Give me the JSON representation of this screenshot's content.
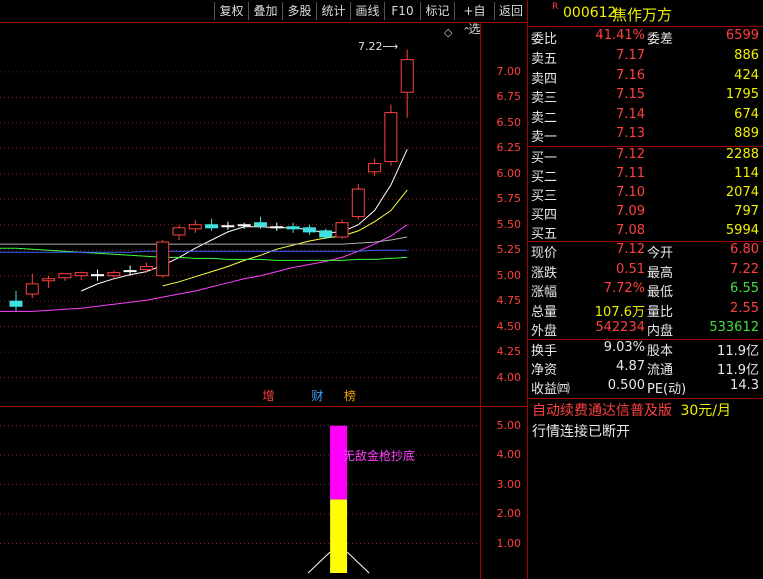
{
  "toolbar": {
    "buttons": [
      "复权",
      "叠加",
      "多股",
      "统计",
      "画线",
      "F10",
      "标记",
      "+自选",
      "返回"
    ]
  },
  "stock": {
    "flag": "R",
    "code": "000612",
    "name": "焦作万方"
  },
  "quote": {
    "webi_label": "委比",
    "webi_value": "41.41%",
    "weicha_label": "委差",
    "weicha_value": "6599",
    "asks": [
      {
        "label": "卖五",
        "price": "7.17",
        "vol": "886"
      },
      {
        "label": "卖四",
        "price": "7.16",
        "vol": "424"
      },
      {
        "label": "卖三",
        "price": "7.15",
        "vol": "1795"
      },
      {
        "label": "卖二",
        "price": "7.14",
        "vol": "674"
      },
      {
        "label": "卖一",
        "price": "7.13",
        "vol": "889"
      }
    ],
    "bids": [
      {
        "label": "买一",
        "price": "7.12",
        "vol": "2288"
      },
      {
        "label": "买二",
        "price": "7.11",
        "vol": "114"
      },
      {
        "label": "买三",
        "price": "7.10",
        "vol": "2074"
      },
      {
        "label": "买四",
        "price": "7.09",
        "vol": "797"
      },
      {
        "label": "买五",
        "price": "7.08",
        "vol": "5994"
      }
    ],
    "stats": [
      {
        "l1": "现价",
        "v1": "7.12",
        "l2": "今开",
        "v2": "6.80"
      },
      {
        "l1": "涨跌",
        "v1": "0.51",
        "l2": "最高",
        "v2": "7.22"
      },
      {
        "l1": "涨幅",
        "v1": "7.72%",
        "l2": "最低",
        "v2": "6.55"
      },
      {
        "l1": "总量",
        "v1": "107.6万",
        "l2": "量比",
        "v2": "2.55"
      },
      {
        "l1": "外盘",
        "v1": "542234",
        "l2": "内盘",
        "v2": "533612"
      }
    ],
    "fund": [
      {
        "l1": "换手",
        "v1": "9.03%",
        "l2": "股本",
        "v2": "11.9亿"
      },
      {
        "l1": "净资",
        "v1": "4.87",
        "l2": "流通",
        "v2": "11.9亿"
      },
      {
        "l1": "收益㈣",
        "v1": "0.500",
        "l2": "PE(动)",
        "v2": "14.3"
      }
    ]
  },
  "ad": {
    "text": "自动续费通达信普及版",
    "price": "30元/月"
  },
  "status": {
    "text": "行情连接已断开"
  },
  "chart_data": [
    {
      "type": "candlestick",
      "title": "",
      "ylim": [
        3.8,
        7.45
      ],
      "yticks": [
        "7.00",
        "6.75",
        "6.50",
        "6.25",
        "6.00",
        "5.75",
        "5.50",
        "5.25",
        "5.00",
        "4.75",
        "4.50",
        "4.25",
        "4.00"
      ],
      "high_annotation": "7.22",
      "candles": [
        {
          "o": 4.75,
          "h": 4.85,
          "l": 4.65,
          "c": 4.7
        },
        {
          "o": 4.82,
          "h": 5.02,
          "l": 4.78,
          "c": 4.92
        },
        {
          "o": 4.95,
          "h": 5.0,
          "l": 4.88,
          "c": 4.97
        },
        {
          "o": 4.98,
          "h": 5.02,
          "l": 4.95,
          "c": 5.02
        },
        {
          "o": 5.0,
          "h": 5.04,
          "l": 4.96,
          "c": 5.03
        },
        {
          "o": 5.01,
          "h": 5.06,
          "l": 4.95,
          "c": 5.01
        },
        {
          "o": 5.0,
          "h": 5.05,
          "l": 4.97,
          "c": 5.03
        },
        {
          "o": 5.04,
          "h": 5.1,
          "l": 5.0,
          "c": 5.05
        },
        {
          "o": 5.06,
          "h": 5.13,
          "l": 5.03,
          "c": 5.09
        },
        {
          "o": 5.0,
          "h": 5.35,
          "l": 4.98,
          "c": 5.33
        },
        {
          "o": 5.4,
          "h": 5.5,
          "l": 5.35,
          "c": 5.47
        },
        {
          "o": 5.46,
          "h": 5.55,
          "l": 5.42,
          "c": 5.5
        },
        {
          "o": 5.5,
          "h": 5.56,
          "l": 5.44,
          "c": 5.47
        },
        {
          "o": 5.49,
          "h": 5.53,
          "l": 5.45,
          "c": 5.49
        },
        {
          "o": 5.5,
          "h": 5.52,
          "l": 5.46,
          "c": 5.5
        },
        {
          "o": 5.52,
          "h": 5.58,
          "l": 5.46,
          "c": 5.49
        },
        {
          "o": 5.48,
          "h": 5.52,
          "l": 5.44,
          "c": 5.47
        },
        {
          "o": 5.48,
          "h": 5.52,
          "l": 5.42,
          "c": 5.46
        },
        {
          "o": 5.47,
          "h": 5.5,
          "l": 5.4,
          "c": 5.43
        },
        {
          "o": 5.44,
          "h": 5.46,
          "l": 5.36,
          "c": 5.38
        },
        {
          "o": 5.38,
          "h": 5.55,
          "l": 5.36,
          "c": 5.52
        },
        {
          "o": 5.58,
          "h": 5.9,
          "l": 5.55,
          "c": 5.85
        },
        {
          "o": 6.02,
          "h": 6.15,
          "l": 5.98,
          "c": 6.1
        },
        {
          "o": 6.12,
          "h": 6.68,
          "l": 6.08,
          "c": 6.6
        },
        {
          "o": 6.8,
          "h": 7.22,
          "l": 6.55,
          "c": 7.12
        }
      ],
      "ma_series": [
        {
          "color": "#ffffff",
          "values": [
            null,
            null,
            null,
            null,
            4.85,
            4.92,
            4.97,
            5.01,
            5.04,
            5.1,
            5.18,
            5.27,
            5.35,
            5.43,
            5.48,
            5.48,
            5.47,
            5.47,
            5.45,
            5.42,
            5.43,
            5.5,
            5.64,
            5.89,
            6.24
          ]
        },
        {
          "color": "#ffff40",
          "values": [
            null,
            null,
            null,
            null,
            null,
            null,
            null,
            null,
            null,
            4.9,
            4.94,
            4.99,
            5.04,
            5.09,
            5.15,
            5.2,
            5.26,
            5.3,
            5.34,
            5.37,
            5.39,
            5.44,
            5.53,
            5.64,
            5.84
          ]
        },
        {
          "color": "#ff40ff",
          "values": [
            4.65,
            4.65,
            4.66,
            4.67,
            4.68,
            4.7,
            4.72,
            4.74,
            4.76,
            4.79,
            4.82,
            4.85,
            4.89,
            4.93,
            4.97,
            5.0,
            5.04,
            5.08,
            5.11,
            5.14,
            5.18,
            5.24,
            5.31,
            5.39,
            5.5
          ]
        },
        {
          "color": "#40ff40",
          "values": [
            5.27,
            5.26,
            5.25,
            5.24,
            5.23,
            5.22,
            5.21,
            5.2,
            5.19,
            5.18,
            5.18,
            5.17,
            5.17,
            5.16,
            5.16,
            5.16,
            5.15,
            5.15,
            5.15,
            5.15,
            5.15,
            5.16,
            5.16,
            5.17,
            5.18
          ]
        },
        {
          "color": "#4060ff",
          "values": [
            5.23,
            5.23,
            5.23,
            5.23,
            5.23,
            5.23,
            5.23,
            5.23,
            5.24,
            5.24,
            5.24,
            5.24,
            5.24,
            5.24,
            5.24,
            5.24,
            5.24,
            5.24,
            5.24,
            5.24,
            5.24,
            5.24,
            5.25,
            5.25,
            5.25
          ]
        },
        {
          "color": "#b0b0b0",
          "values": [
            5.31,
            5.31,
            5.31,
            5.31,
            5.31,
            5.31,
            5.31,
            5.31,
            5.31,
            5.31,
            5.31,
            5.31,
            5.31,
            5.31,
            5.31,
            5.31,
            5.31,
            5.31,
            5.31,
            5.31,
            5.31,
            5.32,
            5.33,
            5.35,
            5.38
          ]
        }
      ],
      "markers": [
        {
          "text": "增",
          "color": "#ff4040",
          "index": 15
        },
        {
          "text": "财",
          "color": "#40a0ff",
          "index": 18
        },
        {
          "text": "榜",
          "color": "#f0a000",
          "index": 20
        }
      ]
    },
    {
      "type": "bar",
      "ylim": [
        0,
        5.5
      ],
      "yticks": [
        "5.00",
        "4.00",
        "3.00",
        "2.00",
        "1.00"
      ],
      "label": "无敌金枪抄底",
      "bar_index": 17,
      "segments": [
        {
          "from": 0,
          "to": 2.5,
          "color": "#ffff00"
        },
        {
          "from": 2.5,
          "to": 5.0,
          "color": "#ff00ff"
        }
      ]
    }
  ]
}
